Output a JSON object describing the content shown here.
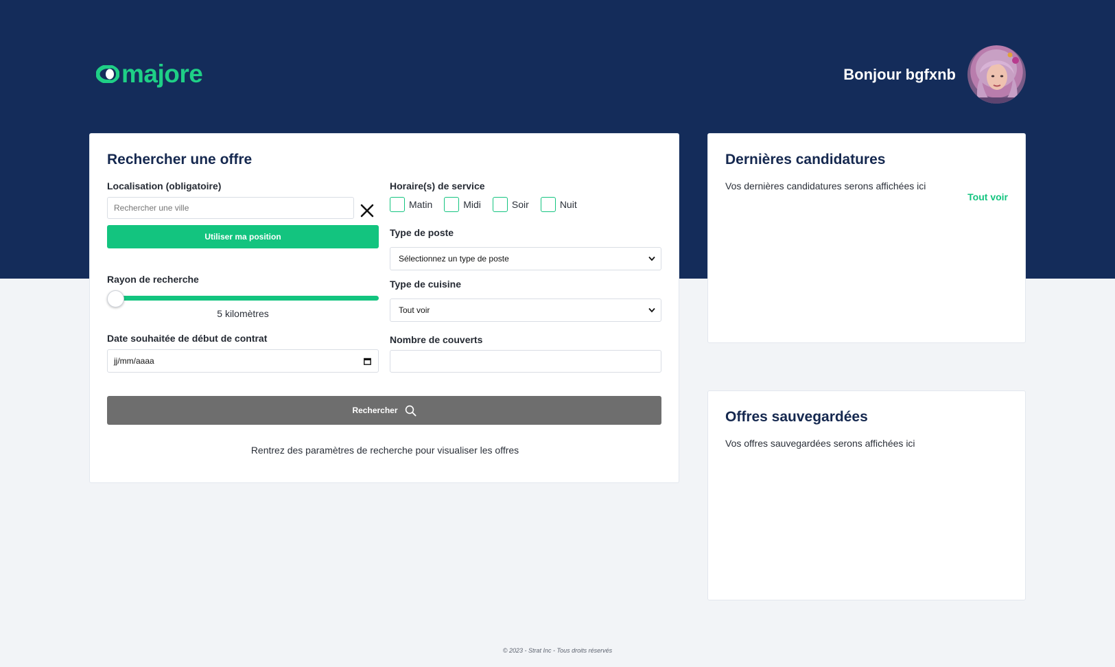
{
  "header": {
    "logo_text": "majore",
    "greeting": "Bonjour bgfxnb",
    "avatar_icon": "user-avatar-photo",
    "background_color": "#142c5a"
  },
  "search_card": {
    "title": "Rechercher une offre",
    "location": {
      "label": "Localisation (obligatoire)",
      "placeholder": "Rechercher une ville",
      "value": "",
      "clear_icon": "close-icon",
      "use_position_label": "Utiliser ma position"
    },
    "radius": {
      "label": "Rayon de recherche",
      "value_text": "5 kilomètres",
      "slider_fraction": 0.0
    },
    "start_date": {
      "label": "Date souhaitée de début de contrat",
      "placeholder": "jj/mm/aaaa",
      "icon": "calendar-icon"
    },
    "service_hours": {
      "label": "Horaire(s) de service",
      "options": [
        {
          "label": "Matin",
          "checked": false
        },
        {
          "label": "Midi",
          "checked": false
        },
        {
          "label": "Soir",
          "checked": false
        },
        {
          "label": "Nuit",
          "checked": false
        }
      ]
    },
    "job_type": {
      "label": "Type de poste",
      "selected": "Sélectionnez un type de poste"
    },
    "cuisine_type": {
      "label": "Type de cuisine",
      "selected": "Tout voir"
    },
    "covers": {
      "label": "Nombre de couverts",
      "value": ""
    },
    "search_button": {
      "label": "Rechercher",
      "icon": "search-icon",
      "color": "#6e6e6e"
    },
    "hint": "Rentrez des paramètres de recherche pour visualiser les offres"
  },
  "applications_card": {
    "title": "Dernières candidatures",
    "empty_text": "Vos dernières candidatures serons affichées ici",
    "see_all": "Tout voir"
  },
  "saved_card": {
    "title": "Offres sauvegardées",
    "empty_text": "Vos offres sauvegardées serons affichées ici"
  },
  "footer": {
    "text": "© 2023 - Strat Inc - Tous droits réservés"
  },
  "colors": {
    "accent": "#13c47f",
    "navy": "#142c5a",
    "page_bg": "#f2f4f7"
  }
}
